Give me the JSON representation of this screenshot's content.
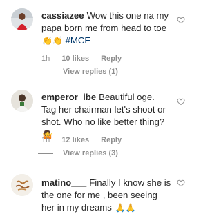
{
  "comments": [
    {
      "username": "cassiazee",
      "text": "Wow this one na my papa born me from head to toe",
      "emojis": "👏👏",
      "hashtag": "#MCE",
      "time": "1h",
      "likes": "10 likes",
      "reply": "Reply",
      "view_replies": "View replies (1)"
    },
    {
      "username": "emperor_ibe",
      "text": "Beautiful oge. Tag her chairman let's shoot or shot. Who no like better thing?",
      "emojis": "🤷",
      "time": "1h",
      "likes": "12 likes",
      "reply": "Reply",
      "view_replies": "View replies (3)"
    },
    {
      "username": "matino___",
      "text": "Finally I know she is the one for me , been seeing her in my dreams",
      "emojis": "🙏🙏"
    }
  ],
  "icons": {
    "like": "heart-outline-icon"
  },
  "colors": {
    "link": "#00376b",
    "secondary_text": "#8e8e8e"
  }
}
